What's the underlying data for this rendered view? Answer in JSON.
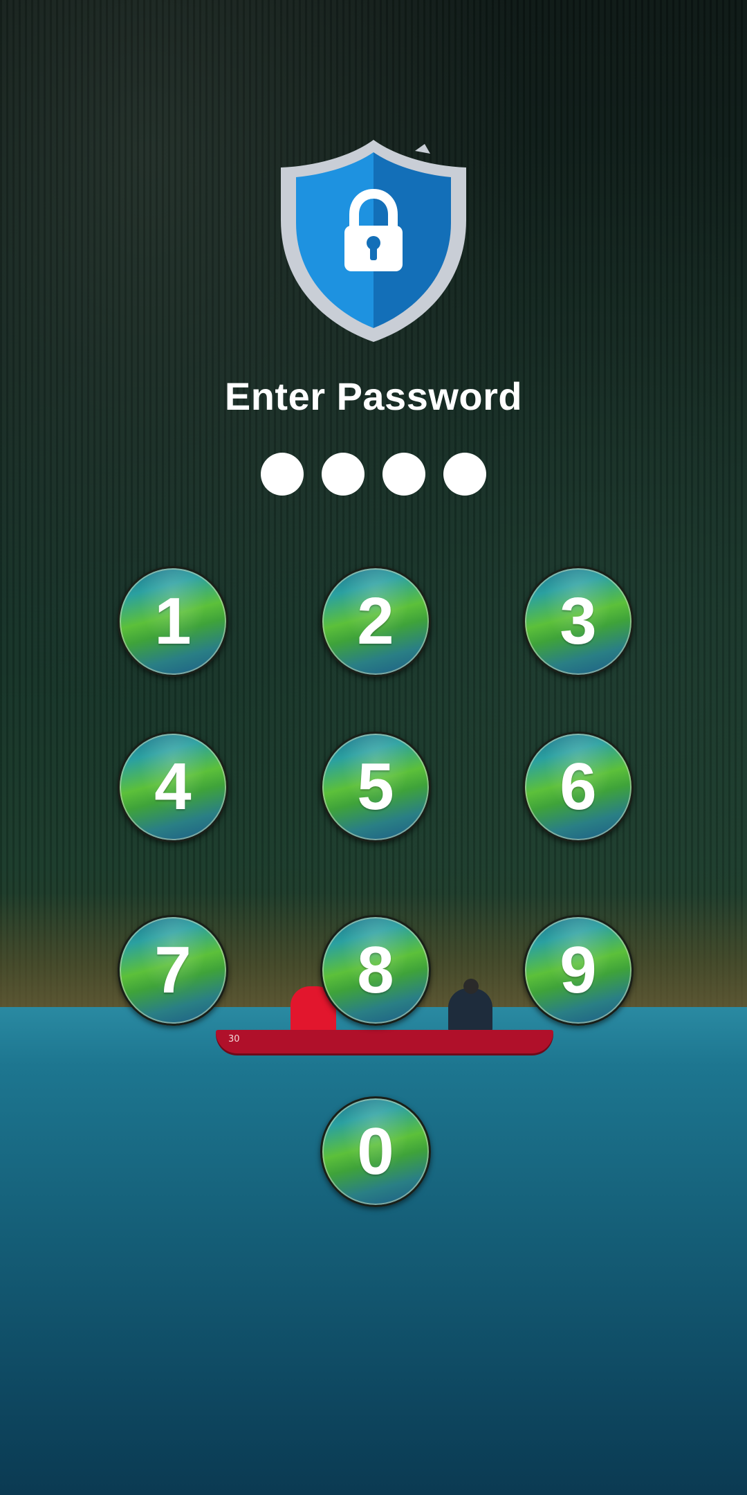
{
  "title": "Enter Password",
  "pin": {
    "length": 4,
    "entered": 0
  },
  "keypad": {
    "keys": [
      "1",
      "2",
      "3",
      "4",
      "5",
      "6",
      "7",
      "8",
      "9",
      "0"
    ]
  },
  "background": {
    "canoe_number": "30"
  },
  "colors": {
    "text": "#ffffff",
    "shield_blue": "#1a8ad8",
    "shield_rim": "#c9ced6",
    "key_green": "#5cc03a",
    "key_blue": "#1b5a86"
  },
  "icons": {
    "logo": "shield-lock-icon"
  }
}
